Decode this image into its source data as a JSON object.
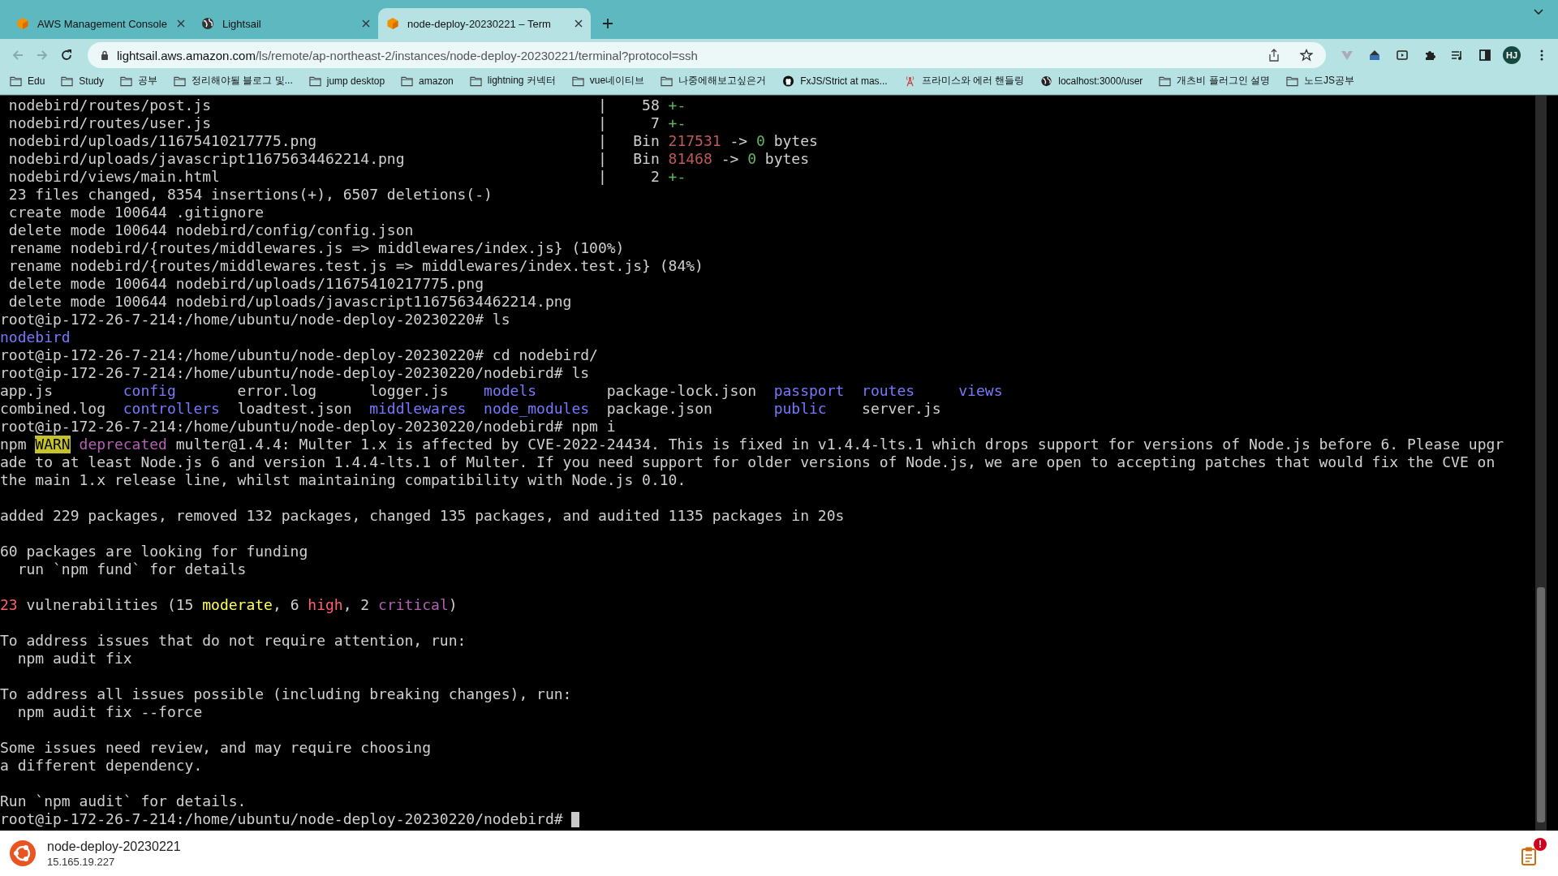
{
  "tabs": [
    {
      "title": "AWS Management Console",
      "selected": false
    },
    {
      "title": "Lightsail",
      "selected": false
    },
    {
      "title": "node-deploy-20230221 – Term",
      "selected": true
    }
  ],
  "address": {
    "host": "lightsail.aws.amazon.com",
    "path": "/ls/remote/ap-northeast-2/instances/node-deploy-20230221/terminal?protocol=ssh"
  },
  "profile": "HJ",
  "bookmarks": [
    {
      "label": "Edu",
      "kind": "folder"
    },
    {
      "label": "Study",
      "kind": "folder"
    },
    {
      "label": "공부",
      "kind": "folder"
    },
    {
      "label": "정리해야될 블로그 및...",
      "kind": "folder"
    },
    {
      "label": "jump desktop",
      "kind": "folder"
    },
    {
      "label": "amazon",
      "kind": "folder"
    },
    {
      "label": "lightning 커넥터",
      "kind": "folder"
    },
    {
      "label": "vue네이티브",
      "kind": "folder"
    },
    {
      "label": "나중에해보고싶은거",
      "kind": "folder"
    },
    {
      "label": "FxJS/Strict at mas...",
      "kind": "github"
    },
    {
      "label": "프라미스와 에러 핸들링",
      "kind": "antenna"
    },
    {
      "label": "localhost:3000/user",
      "kind": "globe"
    },
    {
      "label": "개츠비 플러그인 설명",
      "kind": "folder"
    },
    {
      "label": "노드JS공부",
      "kind": "folder"
    }
  ],
  "terminal": {
    "lines": [
      {
        "kind": "stat",
        "path": " nodebird/routes/post.js",
        "segments": [
          {
            "text": "|    58 ",
            "kind": "plain"
          },
          {
            "text": "+-",
            "kind": "green"
          }
        ]
      },
      {
        "kind": "stat",
        "path": " nodebird/routes/user.js",
        "segments": [
          {
            "text": "|     7 ",
            "kind": "plain"
          },
          {
            "text": "+-",
            "kind": "green"
          }
        ]
      },
      {
        "kind": "stat",
        "path": " nodebird/uploads/11675410217775.png",
        "segments": [
          {
            "text": "|   Bin ",
            "kind": "plain"
          },
          {
            "text": "217531",
            "kind": "red"
          },
          {
            "text": " -> ",
            "kind": "plain"
          },
          {
            "text": "0",
            "kind": "green"
          },
          {
            "text": " bytes",
            "kind": "plain"
          }
        ]
      },
      {
        "kind": "stat",
        "path": " nodebird/uploads/javascript11675634462214.png",
        "segments": [
          {
            "text": "|   Bin ",
            "kind": "plain"
          },
          {
            "text": "81468",
            "kind": "red"
          },
          {
            "text": " -> ",
            "kind": "plain"
          },
          {
            "text": "0",
            "kind": "green"
          },
          {
            "text": " bytes",
            "kind": "plain"
          }
        ]
      },
      {
        "kind": "stat",
        "path": " nodebird/views/main.html",
        "segments": [
          {
            "text": "|     2 ",
            "kind": "plain"
          },
          {
            "text": "+-",
            "kind": "green"
          }
        ]
      },
      {
        "kind": "text",
        "segments": [
          {
            "text": " 23 files changed, 8354 insertions(+), 6507 deletions(-)",
            "kind": "plain"
          }
        ]
      },
      {
        "kind": "text",
        "segments": [
          {
            "text": " create mode 100644 .gitignore",
            "kind": "plain"
          }
        ]
      },
      {
        "kind": "text",
        "segments": [
          {
            "text": " delete mode 100644 nodebird/config/config.json",
            "kind": "plain"
          }
        ]
      },
      {
        "kind": "text",
        "segments": [
          {
            "text": " rename nodebird/{routes/middlewares.js => middlewares/index.js} (100%)",
            "kind": "plain"
          }
        ]
      },
      {
        "kind": "text",
        "segments": [
          {
            "text": " rename nodebird/{routes/middlewares.test.js => middlewares/index.test.js} (84%)",
            "kind": "plain"
          }
        ]
      },
      {
        "kind": "text",
        "segments": [
          {
            "text": " delete mode 100644 nodebird/uploads/11675410217775.png",
            "kind": "plain"
          }
        ]
      },
      {
        "kind": "text",
        "segments": [
          {
            "text": " delete mode 100644 nodebird/uploads/javascript11675634462214.png",
            "kind": "plain"
          }
        ]
      },
      {
        "kind": "text",
        "segments": [
          {
            "text": "root@ip-172-26-7-214:/home/ubuntu/node-deploy-20230220# ls",
            "kind": "plain"
          }
        ]
      },
      {
        "kind": "text",
        "segments": [
          {
            "text": "nodebird",
            "kind": "dir"
          }
        ]
      },
      {
        "kind": "text",
        "segments": [
          {
            "text": "root@ip-172-26-7-214:/home/ubuntu/node-deploy-20230220# cd nodebird/",
            "kind": "plain"
          }
        ]
      },
      {
        "kind": "text",
        "segments": [
          {
            "text": "root@ip-172-26-7-214:/home/ubuntu/node-deploy-20230220/nodebird# ls",
            "kind": "plain"
          }
        ]
      },
      {
        "kind": "listing",
        "rows": [
          [
            {
              "text": "app.js",
              "dir": false
            },
            {
              "text": "config",
              "dir": true
            },
            {
              "text": "error.log",
              "dir": false
            },
            {
              "text": "logger.js",
              "dir": false
            },
            {
              "text": "models",
              "dir": true
            },
            {
              "text": "package-lock.json",
              "dir": false
            },
            {
              "text": "passport",
              "dir": true
            },
            {
              "text": "routes",
              "dir": true
            },
            {
              "text": "views",
              "dir": true
            }
          ],
          [
            {
              "text": "combined.log",
              "dir": false
            },
            {
              "text": "controllers",
              "dir": true
            },
            {
              "text": "loadtest.json",
              "dir": false
            },
            {
              "text": "middlewares",
              "dir": true
            },
            {
              "text": "node_modules",
              "dir": true
            },
            {
              "text": "package.json",
              "dir": false
            },
            {
              "text": "public",
              "dir": true
            },
            {
              "text": "server.js",
              "dir": false
            }
          ]
        ]
      },
      {
        "kind": "text",
        "segments": [
          {
            "text": "root@ip-172-26-7-214:/home/ubuntu/node-deploy-20230220/nodebird# npm i",
            "kind": "plain"
          }
        ]
      },
      {
        "kind": "text",
        "segments": [
          {
            "text": "npm ",
            "kind": "plain"
          },
          {
            "text": "WARN",
            "kind": "warn"
          },
          {
            "text": " deprecated",
            "kind": "magenta"
          },
          {
            "text": " multer@1.4.4: Multer 1.x is affected by CVE-2022-24434. This is fixed in v1.4.4-lts.1 which drops support for versions of Node.js before 6. Please upgr",
            "kind": "plain"
          }
        ]
      },
      {
        "kind": "text",
        "segments": [
          {
            "text": "ade to at least Node.js 6 and version 1.4.4-lts.1 of Multer. If you need support for older versions of Node.js, we are open to accepting patches that would fix the CVE on",
            "kind": "plain"
          }
        ]
      },
      {
        "kind": "text",
        "segments": [
          {
            "text": "the main 1.x release line, whilst maintaining compatibility with Node.js 0.10.",
            "kind": "plain"
          }
        ]
      },
      {
        "kind": "blank"
      },
      {
        "kind": "text",
        "segments": [
          {
            "text": "added 229 packages, removed 132 packages, changed 135 packages, and audited 1135 packages in 20s",
            "kind": "plain"
          }
        ]
      },
      {
        "kind": "blank"
      },
      {
        "kind": "text",
        "segments": [
          {
            "text": "60 packages are looking for funding",
            "kind": "plain"
          }
        ]
      },
      {
        "kind": "text",
        "segments": [
          {
            "text": "  run `npm fund` for details",
            "kind": "plain"
          }
        ]
      },
      {
        "kind": "blank"
      },
      {
        "kind": "text",
        "segments": [
          {
            "text": "23",
            "kind": "pink"
          },
          {
            "text": " vulnerabilities (15 ",
            "kind": "plain"
          },
          {
            "text": "moderate",
            "kind": "yellow"
          },
          {
            "text": ", 6 ",
            "kind": "plain"
          },
          {
            "text": "high",
            "kind": "pink"
          },
          {
            "text": ", 2 ",
            "kind": "plain"
          },
          {
            "text": "critical",
            "kind": "magenta"
          },
          {
            "text": ")",
            "kind": "plain"
          }
        ]
      },
      {
        "kind": "blank"
      },
      {
        "kind": "text",
        "segments": [
          {
            "text": "To address issues that do not require attention, run:",
            "kind": "plain"
          }
        ]
      },
      {
        "kind": "text",
        "segments": [
          {
            "text": "  npm audit fix",
            "kind": "plain"
          }
        ]
      },
      {
        "kind": "blank"
      },
      {
        "kind": "text",
        "segments": [
          {
            "text": "To address all issues possible (including breaking changes), run:",
            "kind": "plain"
          }
        ]
      },
      {
        "kind": "text",
        "segments": [
          {
            "text": "  npm audit fix --force",
            "kind": "plain"
          }
        ]
      },
      {
        "kind": "blank"
      },
      {
        "kind": "text",
        "segments": [
          {
            "text": "Some issues need review, and may require choosing",
            "kind": "plain"
          }
        ]
      },
      {
        "kind": "text",
        "segments": [
          {
            "text": "a different dependency.",
            "kind": "plain"
          }
        ]
      },
      {
        "kind": "blank"
      },
      {
        "kind": "text",
        "segments": [
          {
            "text": "Run `npm audit` for details.",
            "kind": "plain"
          }
        ]
      },
      {
        "kind": "text",
        "segments": [
          {
            "text": "root@ip-172-26-7-214:/home/ubuntu/node-deploy-20230220/nodebird# ",
            "kind": "plain"
          }
        ],
        "cursor": true
      }
    ]
  },
  "instance": {
    "name": "node-deploy-20230221",
    "ip": "15.165.19.227",
    "alert": "!"
  }
}
